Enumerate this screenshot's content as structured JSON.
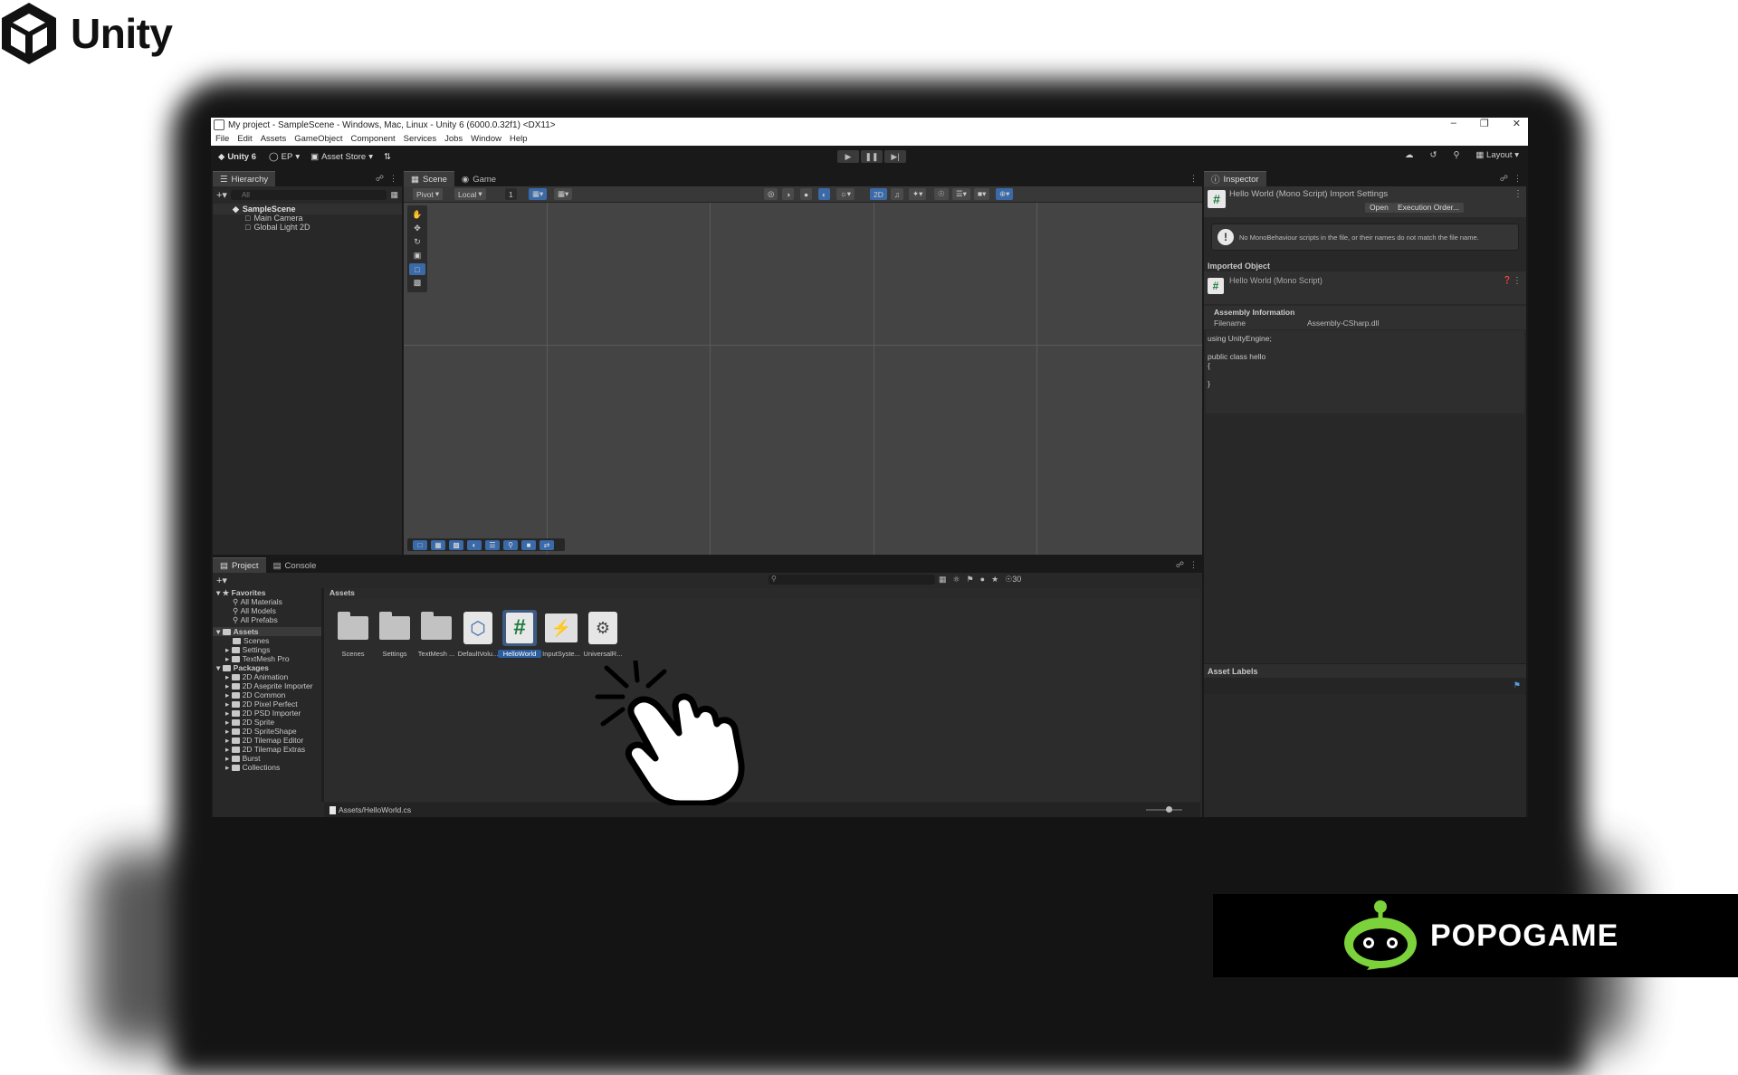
{
  "brand": {
    "unity": "Unity",
    "popogame": "POPOGAME"
  },
  "titlebar": {
    "title": "My project - SampleScene - Windows, Mac, Linux - Unity 6 (6000.0.32f1) <DX11>"
  },
  "menubar": [
    "File",
    "Edit",
    "Assets",
    "GameObject",
    "Component",
    "Services",
    "Jobs",
    "Window",
    "Help"
  ],
  "toolbar": {
    "version": "Unity 6",
    "account": "EP",
    "asset_store": "Asset Store",
    "layout": "Layout"
  },
  "hierarchy": {
    "tab": "Hierarchy",
    "search_placeholder": "All",
    "scene": "SampleScene",
    "items": [
      "Main Camera",
      "Global Light 2D"
    ]
  },
  "scene_view": {
    "tabs": [
      "Scene",
      "Game"
    ],
    "pivot": "Pivot",
    "local": "Local",
    "grid_value": "1",
    "mode_2d": "2D"
  },
  "inspector": {
    "tab": "Inspector",
    "header_title": "Hello World (Mono Script) Import Settings",
    "open_button": "Open",
    "exec_order_button": "Execution Order...",
    "warning": "No MonoBehaviour scripts in the file, or their names do not match the file name.",
    "imported_object_title": "Imported Object",
    "imported_object_name": "Hello World (Mono Script)",
    "assembly_info_title": "Assembly Information",
    "filename_label": "Filename",
    "filename_value": "Assembly-CSharp.dll",
    "code": "using UnityEngine;\n\npublic class hello\n{\n\n}",
    "asset_labels": "Asset Labels"
  },
  "project": {
    "tabs": [
      "Project",
      "Console"
    ],
    "favorites_title": "Favorites",
    "favorites": [
      "All Materials",
      "All Models",
      "All Prefabs"
    ],
    "assets_title": "Assets",
    "assets_tree": [
      "Scenes",
      "Settings",
      "TextMesh Pro"
    ],
    "packages_title": "Packages",
    "packages": [
      "2D Animation",
      "2D Aseprite Importer",
      "2D Common",
      "2D Pixel Perfect",
      "2D PSD Importer",
      "2D Sprite",
      "2D SpriteShape",
      "2D Tilemap Editor",
      "2D Tilemap Extras",
      "Burst",
      "Collections"
    ],
    "breadcrumb": "Assets",
    "asset_items": [
      "Scenes",
      "Settings",
      "TextMesh ...",
      "DefaultVolu...",
      "HelloWorld",
      "InputSyste...",
      "UniversalR..."
    ],
    "selected_asset": "HelloWorld",
    "count": "30",
    "path": "Assets/HelloWorld.cs"
  }
}
